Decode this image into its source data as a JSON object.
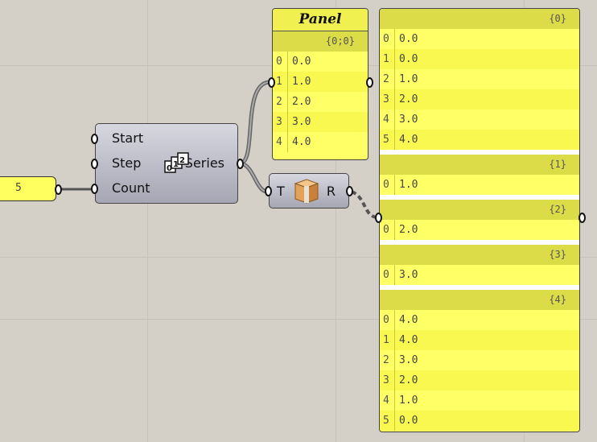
{
  "number_input": {
    "value": "5"
  },
  "series_component": {
    "inputs": [
      "Start",
      "Step",
      "Count"
    ],
    "output": "Series",
    "icon": "series-icon"
  },
  "tree_component": {
    "input": "T",
    "output": "R",
    "icon": "box-icon"
  },
  "panel_small": {
    "title": "Panel",
    "branches": [
      {
        "path": "{0;0}",
        "items": [
          [
            "0",
            "0.0"
          ],
          [
            "1",
            "1.0"
          ],
          [
            "2",
            "2.0"
          ],
          [
            "3",
            "3.0"
          ],
          [
            "4",
            "4.0"
          ]
        ]
      }
    ]
  },
  "panel_large": {
    "branches": [
      {
        "path": "{0}",
        "items": [
          [
            "0",
            "0.0"
          ],
          [
            "1",
            "0.0"
          ],
          [
            "2",
            "1.0"
          ],
          [
            "3",
            "2.0"
          ],
          [
            "4",
            "3.0"
          ],
          [
            "5",
            "4.0"
          ]
        ]
      },
      {
        "path": "{1}",
        "items": [
          [
            "0",
            "1.0"
          ]
        ]
      },
      {
        "path": "{2}",
        "items": [
          [
            "0",
            "2.0"
          ]
        ]
      },
      {
        "path": "{3}",
        "items": [
          [
            "0",
            "3.0"
          ]
        ]
      },
      {
        "path": "{4}",
        "items": [
          [
            "0",
            "4.0"
          ],
          [
            "1",
            "4.0"
          ],
          [
            "2",
            "3.0"
          ],
          [
            "3",
            "2.0"
          ],
          [
            "4",
            "1.0"
          ],
          [
            "5",
            "0.0"
          ]
        ]
      }
    ]
  },
  "colors": {
    "canvas": "#d4d0c8",
    "panel_yellow": "#ffff66",
    "wire": "#555555"
  }
}
